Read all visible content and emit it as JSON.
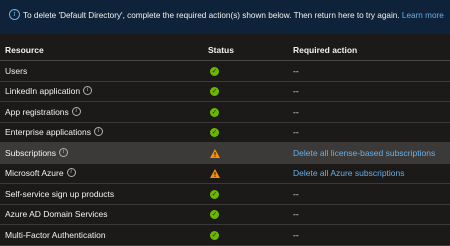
{
  "banner": {
    "message": "To delete 'Default Directory', complete the required action(s) shown below. Then return here to try again.",
    "link": "Learn more"
  },
  "table": {
    "headers": {
      "resource": "Resource",
      "status": "Status",
      "action": "Required action"
    },
    "rows": [
      {
        "resource": "Users",
        "info": false,
        "status": "success",
        "action": "--",
        "action_link": false
      },
      {
        "resource": "LinkedIn application",
        "info": true,
        "status": "success",
        "action": "--",
        "action_link": false
      },
      {
        "resource": "App registrations",
        "info": true,
        "status": "success",
        "action": "--",
        "action_link": false
      },
      {
        "resource": "Enterprise applications",
        "info": true,
        "status": "success",
        "action": "--",
        "action_link": false
      },
      {
        "resource": "Subscriptions",
        "info": true,
        "status": "warning",
        "action": "Delete all license-based subscriptions",
        "action_link": true
      },
      {
        "resource": "Microsoft Azure",
        "info": true,
        "status": "warning",
        "action": "Delete all Azure subscriptions",
        "action_link": true
      },
      {
        "resource": "Self-service sign up products",
        "info": false,
        "status": "success",
        "action": "--",
        "action_link": false
      },
      {
        "resource": "Azure AD Domain Services",
        "info": false,
        "status": "success",
        "action": "--",
        "action_link": false
      },
      {
        "resource": "Multi-Factor Authentication",
        "info": false,
        "status": "success",
        "action": "--",
        "action_link": false
      }
    ]
  },
  "icons": {
    "info": "info-icon",
    "success": "checkmark-circle-icon",
    "warning": "warning-triangle-icon"
  },
  "colors": {
    "background": "#1b1a19",
    "banner": "#0e2339",
    "link": "#69afe5",
    "success": "#6bb700",
    "warning": "#ff8c00",
    "highlight_row": "#3b3a39"
  }
}
